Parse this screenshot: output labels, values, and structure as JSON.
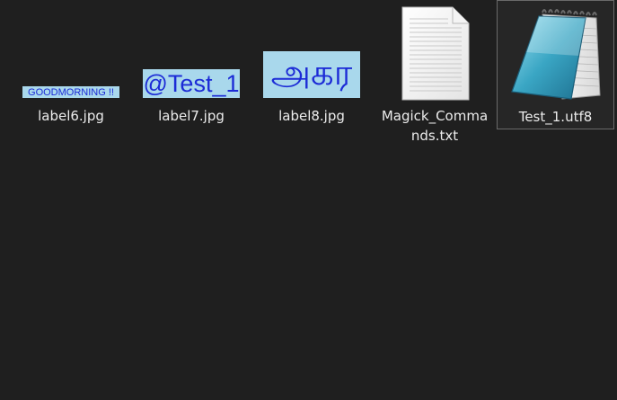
{
  "files": [
    {
      "name": "label6.jpg",
      "thumbnail_text": "GOODMORNING !!"
    },
    {
      "name": "label7.jpg",
      "thumbnail_text": "@Test_1"
    },
    {
      "name": "label8.jpg",
      "thumbnail_text": "அகர"
    },
    {
      "name": "Magick_Commands.txt",
      "icon": "text-document-icon"
    },
    {
      "name": "Test_1.utf8",
      "icon": "notepad-icon",
      "selected": true
    }
  ],
  "colors": {
    "background": "#1f1f1f",
    "thumbnail_bg": "#a9d8ec",
    "thumbnail_text": "#1c2bd6",
    "label_text": "#ececec",
    "selection_border": "#6a6a6a"
  }
}
